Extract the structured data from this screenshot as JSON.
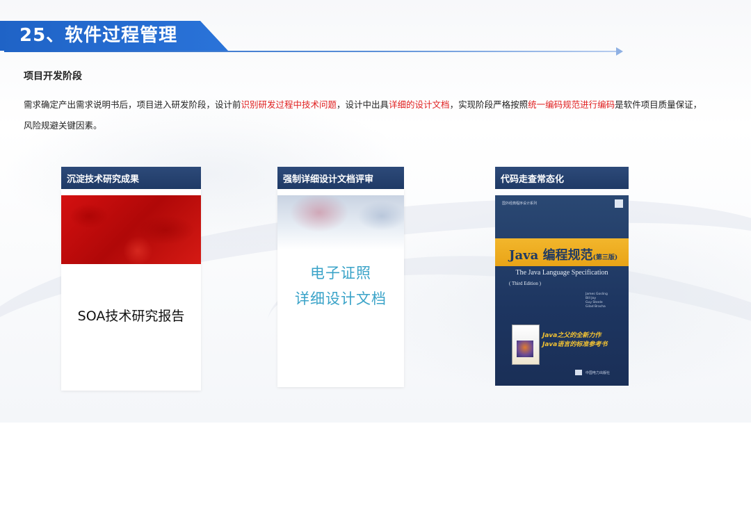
{
  "header": {
    "title": "25、软件过程管理"
  },
  "section": {
    "heading": "项目开发阶段",
    "paragraph_line1": [
      {
        "text": "需求确定产出需求说明书后，项目进入研发阶段，设计前",
        "highlight": false
      },
      {
        "text": "识别研发过程中技术问题",
        "highlight": true
      },
      {
        "text": "，设计中出具",
        "highlight": false
      },
      {
        "text": "详细的设计文档",
        "highlight": true
      },
      {
        "text": "，实现阶段严格按照",
        "highlight": false
      },
      {
        "text": "统一编码规范进行编码",
        "highlight": true
      },
      {
        "text": "是软件项目质量保证，",
        "highlight": false
      }
    ],
    "paragraph_line2": "风险规避关键因素。"
  },
  "cards": [
    {
      "title": "沉淀技术研究成果",
      "body_text": "SOA技术研究报告"
    },
    {
      "title": "强制详细设计文档评审",
      "body_line1": "电子证照",
      "body_line2": "详细设计文档"
    },
    {
      "title": "代码走查常态化"
    }
  ],
  "book": {
    "series": "国外经典程序设计系列",
    "title_prefix": "Java",
    "title_cn": "编程规范",
    "edition_cn": "(第三版)",
    "title_en": "The Java Language Specification",
    "edition_en": "( Third Edition )",
    "authors": "James Gosling\nBill Joy\nGuy Steele\nGilad Bracha",
    "tagline1": "Java之父的全新力作",
    "tagline2": "Java语言的标准参考书",
    "publisher": "中国电力出版社"
  },
  "colors": {
    "accent_blue": "#1f63c6",
    "highlight_red": "#e02020",
    "card_header": "#1f3a66",
    "card2_text": "#3aa3c8"
  }
}
